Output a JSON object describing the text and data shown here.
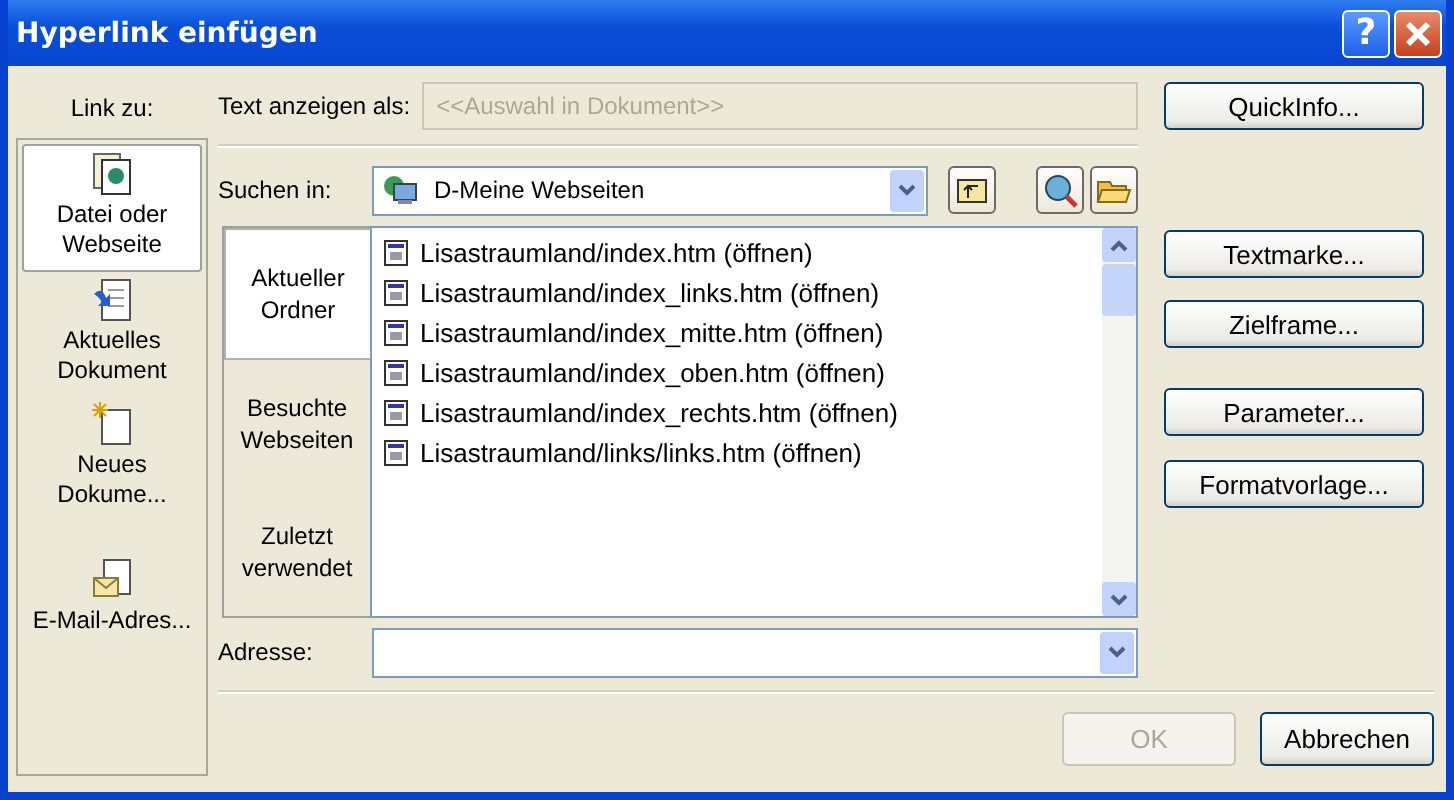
{
  "window": {
    "title": "Hyperlink einfügen",
    "help_label": "?"
  },
  "link_to": {
    "label": "Link zu:",
    "items": [
      {
        "label": "Datei oder Webseite",
        "kind": "file",
        "selected": true
      },
      {
        "label": "Aktuelles Dokument",
        "kind": "document",
        "selected": false
      },
      {
        "label": "Neues Dokume...",
        "kind": "new",
        "selected": false
      },
      {
        "label": "E-Mail-Adres...",
        "kind": "mail",
        "selected": false
      }
    ]
  },
  "display_text": {
    "label": "Text anzeigen als:",
    "value": "<<Auswahl in Dokument>>",
    "disabled": true
  },
  "search_in": {
    "label": "Suchen in:",
    "value": "D-Meine Webseiten"
  },
  "view_tabs": [
    {
      "label": "Aktueller Ordner",
      "selected": true
    },
    {
      "label": "Besuchte Webseiten",
      "selected": false
    },
    {
      "label": "Zuletzt verwendet",
      "selected": false
    }
  ],
  "files": [
    "Lisastraumland/index.htm (öffnen)",
    "Lisastraumland/index_links.htm (öffnen)",
    "Lisastraumland/index_mitte.htm (öffnen)",
    "Lisastraumland/index_oben.htm (öffnen)",
    "Lisastraumland/index_rechts.htm (öffnen)",
    "Lisastraumland/links/links.htm (öffnen)"
  ],
  "address": {
    "label": "Adresse:"
  },
  "side_buttons": [
    "QuickInfo...",
    "Textmarke...",
    "Zielframe...",
    "Parameter...",
    "Formatvorlage..."
  ],
  "footer_buttons": [
    {
      "label": "OK",
      "disabled": true
    },
    {
      "label": "Abbrechen",
      "disabled": false
    }
  ]
}
